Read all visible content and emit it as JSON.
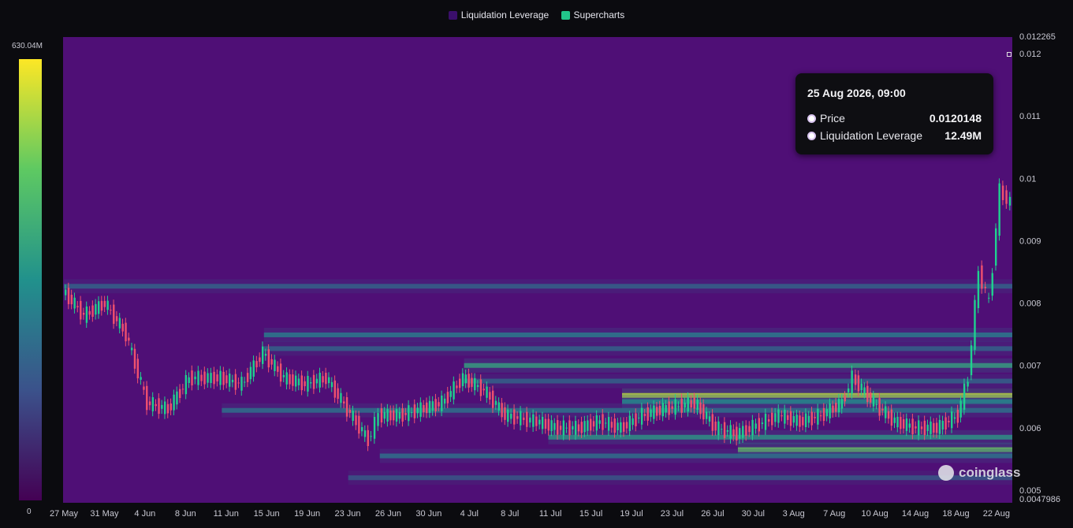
{
  "legend": {
    "items": [
      {
        "label": "Liquidation Leverage",
        "color": "#3b0f6b"
      },
      {
        "label": "Supercharts",
        "color": "#22c48a"
      }
    ]
  },
  "color_scale": {
    "max_label": "630.04M",
    "min_label": "0",
    "colors": [
      "#440154",
      "#3b528b",
      "#21918c",
      "#5ec962",
      "#fde725"
    ]
  },
  "tooltip": {
    "date": "25 Aug 2026, 09:00",
    "rows": [
      {
        "label": "Price",
        "value": "0.0120148"
      },
      {
        "label": "Liquidation Leverage",
        "value": "12.49M"
      }
    ]
  },
  "watermark": "coinglass",
  "chart_data": {
    "type": "heatmap",
    "title": "",
    "x_ticks": [
      "27 May",
      "31 May",
      "4 Jun",
      "8 Jun",
      "11 Jun",
      "15 Jun",
      "19 Jun",
      "23 Jun",
      "26 Jun",
      "30 Jun",
      "4 Jul",
      "8 Jul",
      "11 Jul",
      "15 Jul",
      "19 Jul",
      "23 Jul",
      "26 Jul",
      "30 Jul",
      "3 Aug",
      "7 Aug",
      "10 Aug",
      "14 Aug",
      "18 Aug",
      "22 Aug"
    ],
    "y_ticks": [
      "0.012265",
      "0.012",
      "0.011",
      "0.01",
      "0.009",
      "0.008",
      "0.007",
      "0.006",
      "0.005",
      "0.0047986"
    ],
    "ylim": [
      0.0047986,
      0.012265
    ],
    "price_series": {
      "name": "Price",
      "dates": [
        "27 May",
        "29 May",
        "31 May",
        "2 Jun",
        "4 Jun",
        "6 Jun",
        "8 Jun",
        "11 Jun",
        "13 Jun",
        "15 Jun",
        "17 Jun",
        "19 Jun",
        "21 Jun",
        "23 Jun",
        "25 Jun",
        "26 Jun",
        "28 Jun",
        "30 Jun",
        "2 Jul",
        "4 Jul",
        "6 Jul",
        "8 Jul",
        "11 Jul",
        "13 Jul",
        "15 Jul",
        "17 Jul",
        "19 Jul",
        "21 Jul",
        "23 Jul",
        "26 Jul",
        "28 Jul",
        "30 Jul",
        "3 Aug",
        "5 Aug",
        "7 Aug",
        "9 Aug",
        "10 Aug",
        "12 Aug",
        "14 Aug",
        "16 Aug",
        "18 Aug",
        "20 Aug",
        "21 Aug",
        "22 Aug",
        "23 Aug",
        "24 Aug",
        "25 Aug"
      ],
      "values": [
        0.0082,
        0.0078,
        0.008,
        0.0075,
        0.0064,
        0.0063,
        0.0068,
        0.0068,
        0.0067,
        0.0072,
        0.0068,
        0.0067,
        0.0068,
        0.0063,
        0.0058,
        0.0062,
        0.0062,
        0.0063,
        0.0064,
        0.0068,
        0.0066,
        0.0062,
        0.0061,
        0.006,
        0.006,
        0.0061,
        0.006,
        0.0062,
        0.0063,
        0.0064,
        0.006,
        0.0059,
        0.0062,
        0.0061,
        0.0062,
        0.0064,
        0.0068,
        0.0064,
        0.0061,
        0.006,
        0.006,
        0.0062,
        0.0068,
        0.0085,
        0.008,
        0.0098,
        0.0096
      ]
    },
    "liquidation_bands": [
      {
        "price": 0.00827,
        "intensity": 0.35,
        "start": "27 May"
      },
      {
        "price": 0.00749,
        "intensity": 0.45,
        "start": "15 Jun"
      },
      {
        "price": 0.00727,
        "intensity": 0.35,
        "start": "15 Jun"
      },
      {
        "price": 0.007,
        "intensity": 0.6,
        "start": "4 Jul"
      },
      {
        "price": 0.00675,
        "intensity": 0.35,
        "start": "4 Jul"
      },
      {
        "price": 0.00652,
        "intensity": 0.95,
        "start": "19 Jul"
      },
      {
        "price": 0.00642,
        "intensity": 0.5,
        "start": "19 Jul"
      },
      {
        "price": 0.00628,
        "intensity": 0.4,
        "start": "11 Jun"
      },
      {
        "price": 0.00585,
        "intensity": 0.55,
        "start": "12 Jul"
      },
      {
        "price": 0.00565,
        "intensity": 0.8,
        "start": "30 Jul"
      },
      {
        "price": 0.00555,
        "intensity": 0.4,
        "start": "26 Jun"
      },
      {
        "price": 0.0052,
        "intensity": 0.3,
        "start": "23 Jun"
      }
    ]
  }
}
